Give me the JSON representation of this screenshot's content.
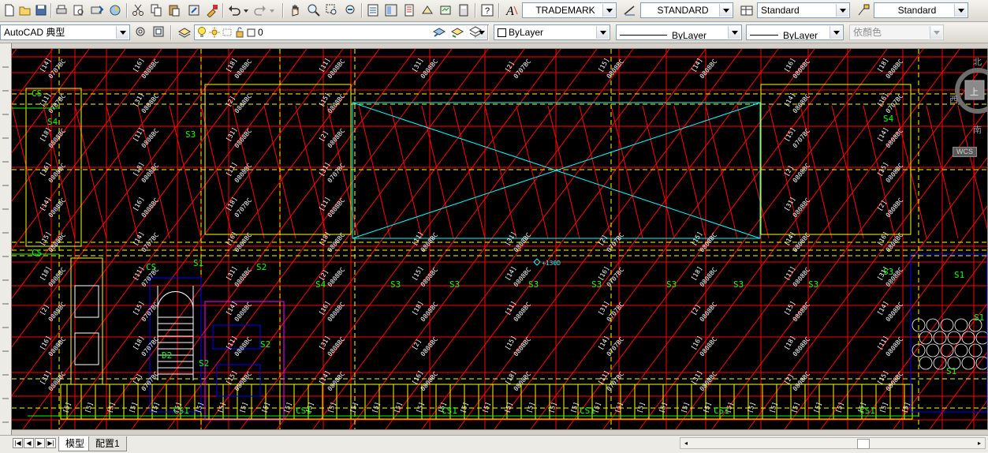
{
  "toolbar1": {
    "text_style": "TRADEMARK",
    "dim_style": "STANDARD",
    "table_style": "Standard",
    "mleader_style": "Standard"
  },
  "toolbar2": {
    "workspace": "AutoCAD 典型",
    "layer": "0",
    "color": "ByLayer",
    "linetype": "ByLayer",
    "lineweight": "ByLayer",
    "plot_style": "依顏色"
  },
  "drawing": {
    "cursor_readout": "+130D",
    "labels_s": [
      "S4",
      "S4",
      "S3",
      "S4",
      "S3",
      "S3",
      "S3",
      "S3",
      "S3",
      "S3",
      "S3",
      "S3",
      "S1",
      "S1",
      "S2",
      "S2",
      "S2",
      "S1",
      "S1"
    ],
    "labels_cs": [
      "CS",
      "CS",
      "CS",
      "CS1",
      "CS1",
      "CS1",
      "CS1",
      "CS1",
      "CS1"
    ],
    "label_d2": "D2",
    "member_code": "0808BC",
    "member_code_alt": "0707BC",
    "index_tags": [
      "[14]",
      "[16]",
      "[18]",
      "[11]",
      "[31]",
      "[2]",
      "[15]"
    ]
  },
  "viewcube": {
    "north": "北",
    "top": "上",
    "west": "西",
    "south": "南",
    "wcs": "WCS"
  },
  "tabs": {
    "model": "模型",
    "layout1": "配置1"
  },
  "colors": {
    "canvas_bg": "#000000",
    "red": "#ff0000",
    "yellow": "#ffff00",
    "cyan": "#00ffff",
    "blue": "#0000ff",
    "magenta": "#ff00ff",
    "green": "#00ff00",
    "white": "#ffffff"
  },
  "icons": {
    "row1": [
      "new-icon",
      "open-icon",
      "save-icon",
      "print-icon",
      "plot-preview-icon",
      "publish-icon",
      "3d-print-icon",
      "cut-icon",
      "copy-icon",
      "paste-icon",
      "match-properties-icon",
      "undo-icon",
      "redo-icon",
      "pan-icon",
      "zoom-realtime-icon",
      "zoom-window-icon",
      "zoom-previous-icon",
      "properties-icon",
      "design-center-icon",
      "tool-palettes-icon",
      "sheet-set-icon",
      "markup-icon",
      "calculator-icon",
      "help-icon",
      "text-style-icon",
      "dim-style-icon",
      "table-style-icon",
      "mleader-style-icon"
    ],
    "row2": [
      "workspace-settings-icon",
      "workspace-customize-icon",
      "layer-properties-icon",
      "lightbulb-icon",
      "sun-icon",
      "layer-state-icon",
      "lock-icon",
      "color-swatch-icon",
      "make-current-icon",
      "layer-previous-icon",
      "layer-states-icon"
    ]
  }
}
